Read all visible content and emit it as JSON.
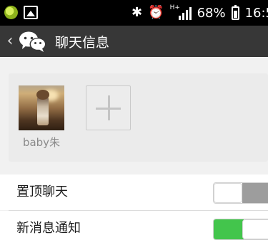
{
  "status_bar": {
    "battery_text": "68%",
    "time": "16:5",
    "network_type": "H+",
    "icons": [
      "app-notification-icon",
      "picture-icon",
      "bluetooth-icon",
      "alarm-icon",
      "signal-icon",
      "battery-icon"
    ]
  },
  "title_bar": {
    "title": "聊天信息",
    "background": "#373737"
  },
  "members": [
    {
      "name": "baby朱"
    }
  ],
  "settings": {
    "pin_chat": {
      "label": "置顶聊天",
      "enabled": false
    },
    "new_message_notify": {
      "label": "新消息通知",
      "enabled": true
    }
  },
  "colors": {
    "toggle_on": "#43c54c",
    "toggle_off": "#9d9d9d",
    "page_background": "#f1f1f1"
  }
}
